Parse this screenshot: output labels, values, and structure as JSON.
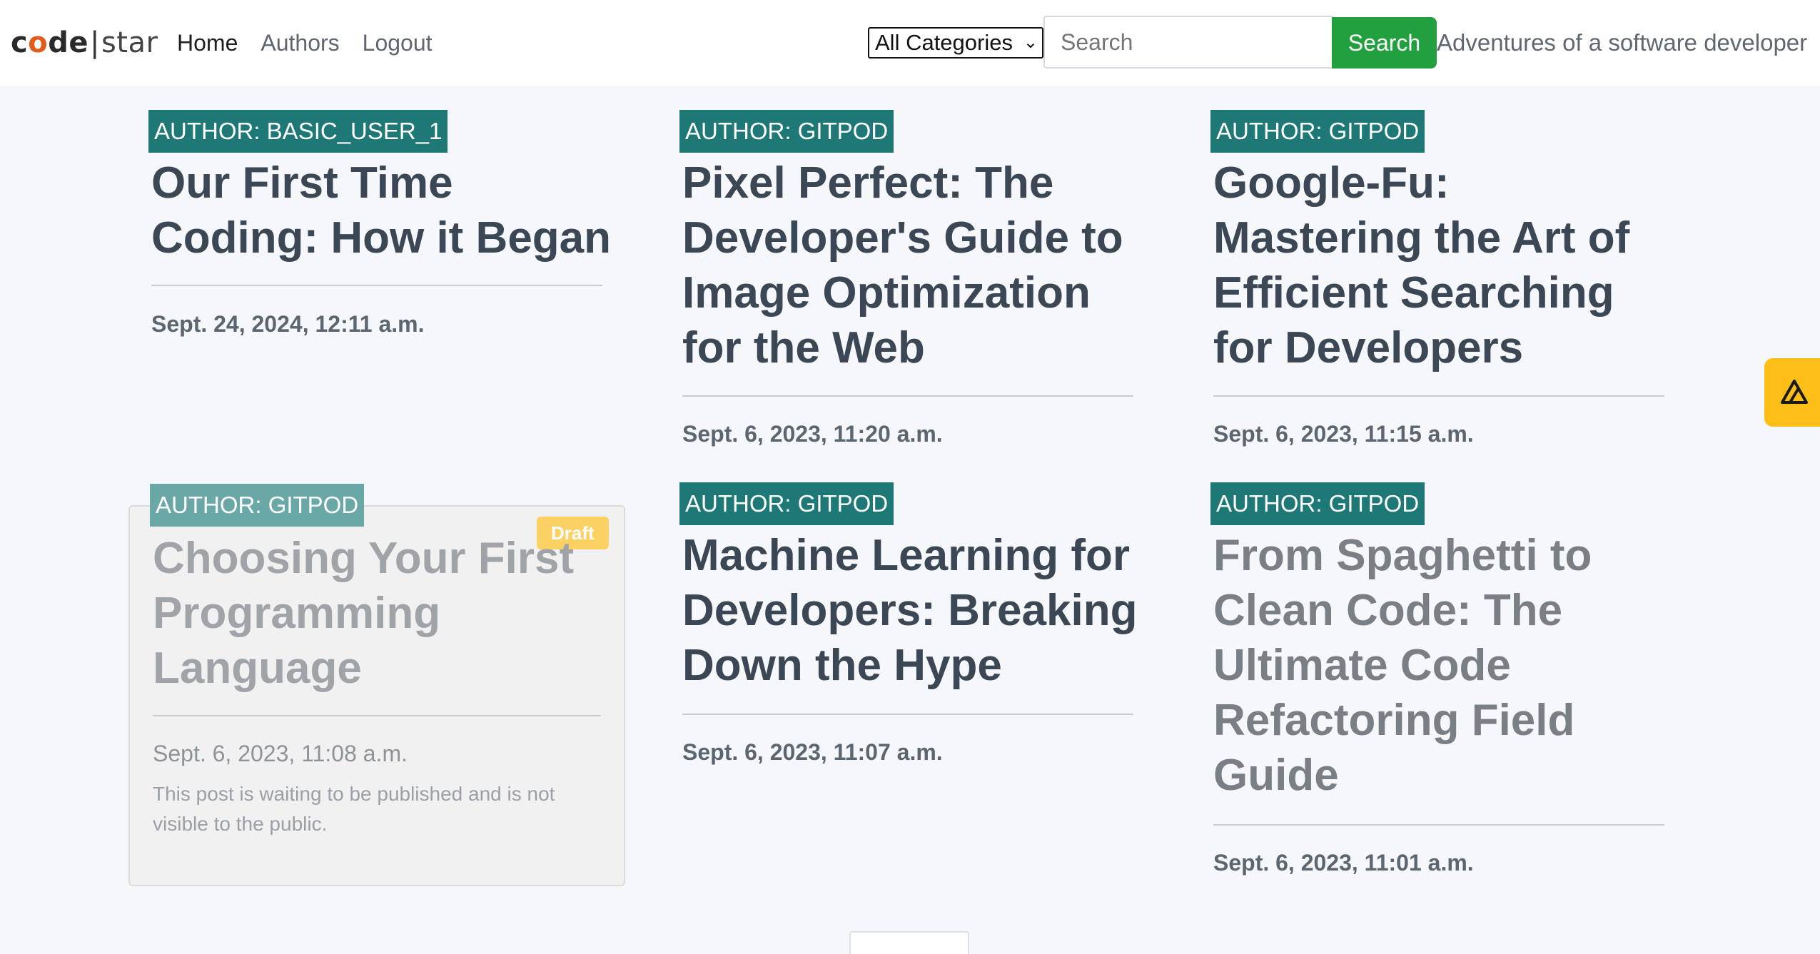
{
  "brand": {
    "code": "code",
    "separator": "|",
    "star": "star"
  },
  "nav": {
    "home": "Home",
    "authors": "Authors",
    "logout": "Logout"
  },
  "search": {
    "category_selected": "All Categories",
    "placeholder": "Search",
    "button_label": "Search"
  },
  "tagline": "Adventures of a software developer",
  "posts": [
    {
      "author": "AUTHOR: BASIC_USER_1",
      "title": "Our First Time Coding: How it Began",
      "date": "Sept. 24, 2024, 12:11 a.m."
    },
    {
      "author": "AUTHOR: GITPOD",
      "title": "Pixel Perfect: The Developer's Guide to Image Optimization for the Web",
      "date": "Sept. 6, 2023, 11:20 a.m."
    },
    {
      "author": "AUTHOR: GITPOD",
      "title": "Google-Fu: Mastering the Art of Efficient Searching for Developers",
      "date": "Sept. 6, 2023, 11:15 a.m."
    },
    {
      "author": "AUTHOR: GITPOD",
      "title": "Choosing Your First Programming Language",
      "date": "Sept. 6, 2023, 11:08 a.m.",
      "status": "Draft",
      "note": "This post is waiting to be published and is not visible to the public."
    },
    {
      "author": "AUTHOR: GITPOD",
      "title": "Machine Learning for Developers: Breaking Down the Hype",
      "date": "Sept. 6, 2023, 11:07 a.m."
    },
    {
      "author": "AUTHOR: GITPOD",
      "title": "From Spaghetti to Clean Code: The Ultimate Code Refactoring Field Guide",
      "date": "Sept. 6, 2023, 11:01 a.m."
    }
  ],
  "colors": {
    "badge": "#1d7876",
    "search_button": "#22a03f",
    "draft_badge": "#fcd163",
    "widget": "#fcbe17",
    "brand_accent": "#e25b1c"
  },
  "icons": {
    "widget": "vercel-toolbar-icon"
  }
}
